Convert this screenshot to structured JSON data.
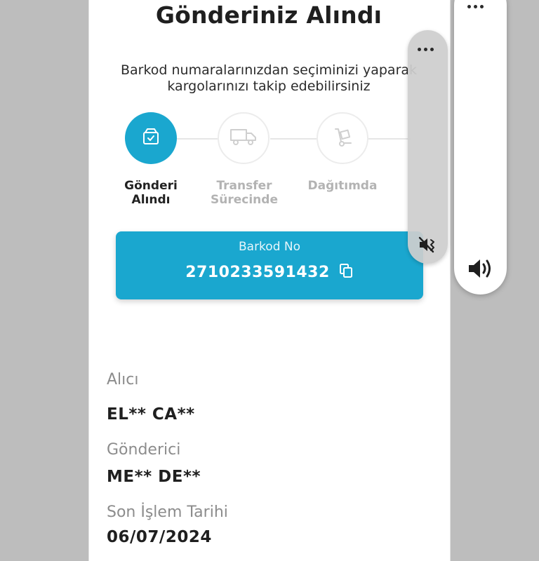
{
  "page": {
    "title": "Gönderiniz Alındı",
    "subtitle_line1": "Barkod numaralarınızdan seçiminizi yaparak",
    "subtitle_line2": "kargolarınızı takip edebilirsiniz"
  },
  "steps": [
    {
      "line1": "Gönderi",
      "line2": "Alındı",
      "icon": "package-check-icon",
      "state": "active"
    },
    {
      "line1": "Transfer",
      "line2": "Sürecinde",
      "icon": "truck-icon",
      "state": "inactive"
    },
    {
      "line1": "Dağıtımda",
      "line2": "",
      "icon": "hand-truck-icon",
      "state": "inactive"
    }
  ],
  "barcode": {
    "label": "Barkod No",
    "value": "2710233591432",
    "copy_icon": "copy-icon"
  },
  "details": {
    "recipient_label": "Alıcı",
    "recipient_value": "EL** CA**",
    "sender_label": "Gönderici",
    "sender_value": "ME** DE**",
    "last_action_label": "Son İşlem Tarihi",
    "last_action_value": "06/07/2024"
  },
  "volume_panel": {
    "mute_icon": "vibrate-mute-icon",
    "volume_icon": "speaker-volume-icon",
    "more_icon": "more-options-icon"
  },
  "colors": {
    "accent": "#1aa7cf",
    "background": "#bdbdbd",
    "inactive_text": "#b3b3b3"
  }
}
